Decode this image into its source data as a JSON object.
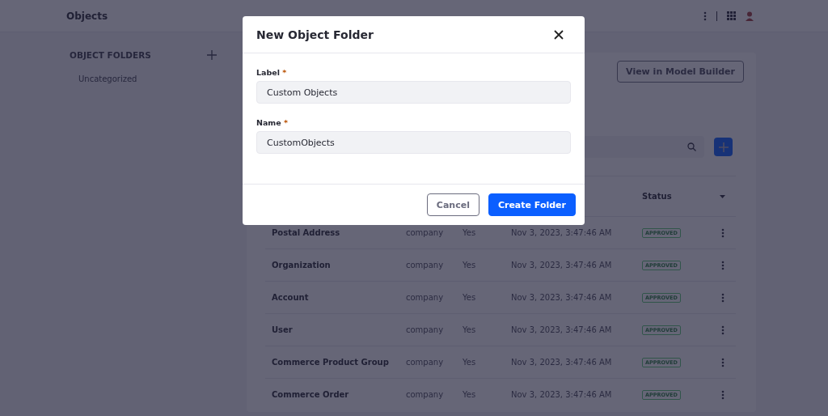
{
  "header": {
    "title": "Objects"
  },
  "sidebar": {
    "heading": "OBJECT FOLDERS",
    "items": [
      {
        "label": "Uncategorized"
      }
    ]
  },
  "main": {
    "model_builder_button": "View in Model Builder"
  },
  "table": {
    "status_header": "Status",
    "rows": [
      {
        "name": "Postal Address",
        "scope": "company",
        "system": "Yes",
        "modified": "Nov 3, 2023, 3:47:46 AM",
        "status": "APPROVED"
      },
      {
        "name": "Organization",
        "scope": "company",
        "system": "Yes",
        "modified": "Nov 3, 2023, 3:47:46 AM",
        "status": "APPROVED"
      },
      {
        "name": "Account",
        "scope": "company",
        "system": "Yes",
        "modified": "Nov 3, 2023, 3:47:46 AM",
        "status": "APPROVED"
      },
      {
        "name": "User",
        "scope": "company",
        "system": "Yes",
        "modified": "Nov 3, 2023, 3:47:46 AM",
        "status": "APPROVED"
      },
      {
        "name": "Commerce Product Group",
        "scope": "company",
        "system": "Yes",
        "modified": "Nov 3, 2023, 3:47:46 AM",
        "status": "APPROVED"
      },
      {
        "name": "Commerce Order",
        "scope": "company",
        "system": "Yes",
        "modified": "Nov 3, 2023, 3:47:46 AM",
        "status": "APPROVED"
      }
    ]
  },
  "modal": {
    "title": "New Object Folder",
    "fields": [
      {
        "label": "Label",
        "required_mark": "*",
        "value": "Custom Objects"
      },
      {
        "label": "Name",
        "required_mark": "*",
        "value": "CustomObjects"
      }
    ],
    "buttons": [
      {
        "label": "Cancel",
        "kind": "secondary"
      },
      {
        "label": "Create Folder",
        "kind": "primary"
      }
    ]
  }
}
